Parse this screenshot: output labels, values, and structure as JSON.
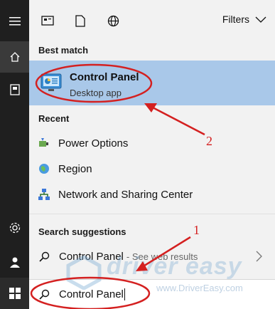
{
  "taskbar": {
    "items": [
      {
        "name": "menu",
        "icon": "hamburger-icon"
      },
      {
        "name": "home",
        "icon": "home-icon",
        "active": true
      },
      {
        "name": "documents",
        "icon": "document-icon"
      },
      {
        "name": "settings",
        "icon": "gear-icon"
      },
      {
        "name": "account",
        "icon": "user-icon"
      },
      {
        "name": "start",
        "icon": "windows-logo-icon"
      }
    ]
  },
  "topbar": {
    "icons": [
      "apps-icon",
      "document-icon",
      "globe-icon"
    ],
    "filters_label": "Filters"
  },
  "best_match": {
    "heading": "Best match",
    "title": "Control Panel",
    "subtitle": "Desktop app",
    "icon": "control-panel-icon"
  },
  "recent": {
    "heading": "Recent",
    "items": [
      {
        "label": "Power Options",
        "icon": "power-options-icon"
      },
      {
        "label": "Region",
        "icon": "region-globe-icon"
      },
      {
        "label": "Network and Sharing Center",
        "icon": "network-icon"
      }
    ]
  },
  "suggestions": {
    "heading": "Search suggestions",
    "item_label": "Control Panel",
    "item_hint": "- See web results"
  },
  "search": {
    "value": "Control Panel"
  },
  "watermark": {
    "brand": "driver easy",
    "url": "www.DriverEasy.com"
  },
  "annotations": {
    "label_1": "1",
    "label_2": "2",
    "color": "#d42020"
  },
  "colors": {
    "highlight": "#a9c8e9",
    "taskbar": "#1f1f1f",
    "panel": "#f2f2f2"
  }
}
